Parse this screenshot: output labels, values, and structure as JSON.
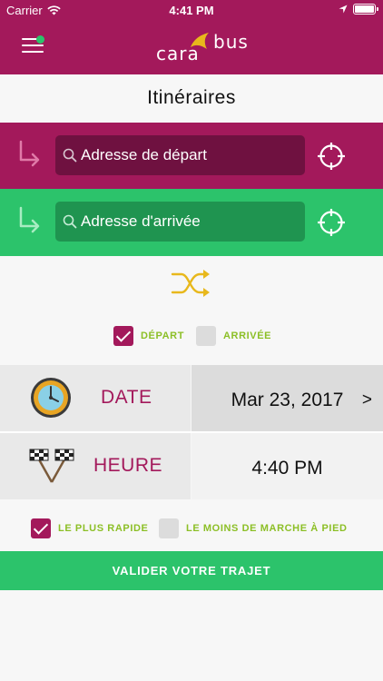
{
  "status_bar": {
    "carrier": "Carrier",
    "time": "4:41 PM"
  },
  "nav": {
    "logo_left": "cara",
    "logo_right": "bus"
  },
  "page_title": "Itinéraires",
  "depart_field": {
    "placeholder": "Adresse de départ"
  },
  "arrivee_field": {
    "placeholder": "Adresse d'arrivée"
  },
  "mode": {
    "depart_label": "DÉPART",
    "depart_checked": true,
    "arrivee_label": "ARRIVÉE",
    "arrivee_checked": false
  },
  "date_row": {
    "label": "DATE",
    "value": "Mar 23, 2017",
    "chevron": ">"
  },
  "heure_row": {
    "label": "HEURE",
    "value": "4:40 PM"
  },
  "options": {
    "fastest_label": "LE PLUS RAPIDE",
    "fastest_checked": true,
    "least_walking_label": "LE MOINS DE MARCHE À PIED",
    "least_walking_checked": false
  },
  "validate_button": "VALIDER VOTRE TRAJET",
  "colors": {
    "brand": "#a3195b",
    "green": "#2cc36b",
    "accent_yellow": "#e8b81c",
    "option_text": "#8cbf26"
  }
}
